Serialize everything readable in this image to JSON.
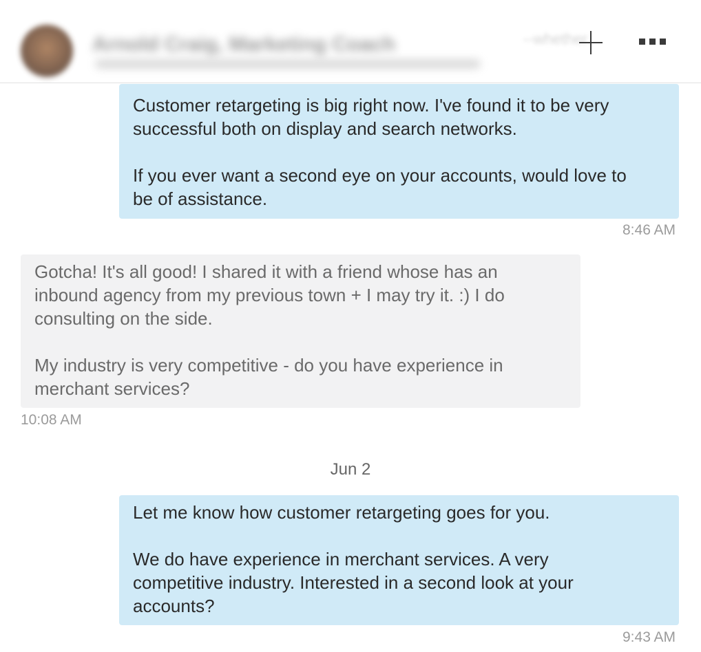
{
  "header": {
    "contact_name": "Arnold Craig, Marketing Coach",
    "contact_subtitle": "Helping businesses grow online",
    "preview_text": "--whether",
    "add_icon": "plus-icon",
    "more_icon": "more-icon"
  },
  "messages": [
    {
      "direction": "outgoing",
      "paragraphs": [
        "Customer retargeting is big right now. I've found it to be very\nsuccessful both on display and search networks.",
        "If you ever want a second eye on your accounts, would love to\nbe of assistance."
      ],
      "time": "8:46 AM"
    },
    {
      "direction": "incoming",
      "paragraphs": [
        "Gotcha! It's all good! I shared it with a friend whose has an\ninbound agency from my previous town + I may try it. :) I do\nconsulting on the side.",
        "My industry is very competitive - do you have experience in\nmerchant services?"
      ],
      "time": "10:08 AM"
    },
    {
      "date_separator": "Jun 2"
    },
    {
      "direction": "outgoing",
      "paragraphs": [
        "Let me know how customer retargeting goes for you.",
        "We do have experience in merchant services. A very\ncompetitive industry. Interested in a second look at your\naccounts?"
      ],
      "time": "9:43 AM"
    }
  ],
  "colors": {
    "outgoing_bubble": "#d0eaf7",
    "incoming_bubble": "#f2f2f3",
    "timestamp": "#9b9b9b"
  }
}
